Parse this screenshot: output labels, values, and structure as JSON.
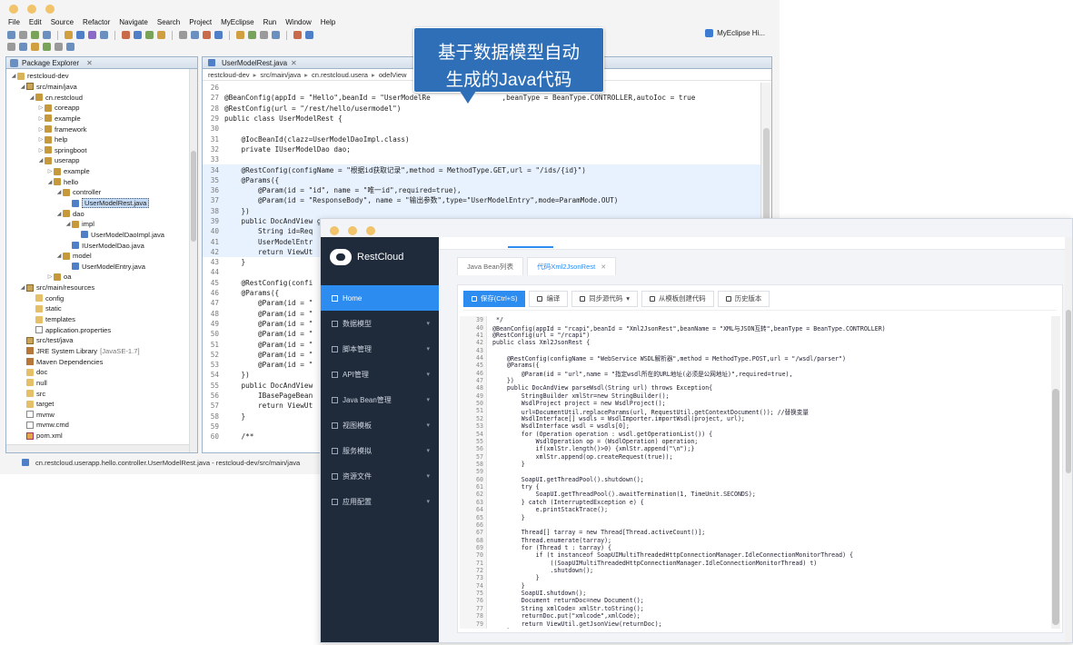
{
  "eclipse": {
    "menu": [
      "File",
      "Edit",
      "Source",
      "Refactor",
      "Navigate",
      "Search",
      "Project",
      "MyEclipse",
      "Run",
      "Window",
      "Help"
    ],
    "perspective_label": "MyEclipse Hi...",
    "package_explorer_title": "Package Explorer",
    "tree": [
      {
        "label": "restcloud-dev",
        "icon": "project-icon",
        "level": 0,
        "expanded": true
      },
      {
        "label": "src/main/java",
        "icon": "source-folder-icon",
        "level": 1,
        "expanded": true
      },
      {
        "label": "cn.restcloud",
        "icon": "package-icon",
        "level": 2,
        "expanded": true
      },
      {
        "label": "coreapp",
        "icon": "package-icon",
        "level": 3,
        "expanded": false
      },
      {
        "label": "example",
        "icon": "package-icon",
        "level": 3,
        "expanded": false
      },
      {
        "label": "framework",
        "icon": "package-icon",
        "level": 3,
        "expanded": false
      },
      {
        "label": "help",
        "icon": "package-icon",
        "level": 3,
        "expanded": false
      },
      {
        "label": "springboot",
        "icon": "package-icon",
        "level": 3,
        "expanded": false
      },
      {
        "label": "userapp",
        "icon": "package-icon",
        "level": 3,
        "expanded": true
      },
      {
        "label": "example",
        "icon": "package-icon",
        "level": 4,
        "expanded": false
      },
      {
        "label": "hello",
        "icon": "package-icon",
        "level": 4,
        "expanded": true
      },
      {
        "label": "controller",
        "icon": "package-icon",
        "level": 5,
        "expanded": true
      },
      {
        "label": "UserModelRest.java",
        "icon": "java-file-icon",
        "level": 6,
        "selected": true
      },
      {
        "label": "dao",
        "icon": "package-icon",
        "level": 5,
        "expanded": true
      },
      {
        "label": "impl",
        "icon": "package-icon",
        "level": 6,
        "expanded": true
      },
      {
        "label": "UserModelDaoImpl.java",
        "icon": "java-file-icon",
        "level": 7
      },
      {
        "label": "IUserModelDao.java",
        "icon": "java-file-icon",
        "level": 6
      },
      {
        "label": "model",
        "icon": "package-icon",
        "level": 5,
        "expanded": true
      },
      {
        "label": "UserModelEntry.java",
        "icon": "java-file-icon",
        "level": 6
      },
      {
        "label": "oa",
        "icon": "package-icon",
        "level": 4,
        "expanded": false
      },
      {
        "label": "src/main/resources",
        "icon": "source-folder-icon",
        "level": 1,
        "expanded": true
      },
      {
        "label": "config",
        "icon": "folder-icon",
        "level": 2
      },
      {
        "label": "static",
        "icon": "folder-icon",
        "level": 2
      },
      {
        "label": "templates",
        "icon": "folder-icon",
        "level": 2
      },
      {
        "label": "application.properties",
        "icon": "file-icon",
        "level": 2
      },
      {
        "label": "src/test/java",
        "icon": "source-folder-icon",
        "level": 1
      },
      {
        "label": "JRE System Library",
        "suffix": "[JavaSE-1.7]",
        "icon": "library-icon",
        "level": 1
      },
      {
        "label": "Maven Dependencies",
        "icon": "library-icon",
        "level": 1
      },
      {
        "label": "doc",
        "icon": "folder-icon",
        "level": 1
      },
      {
        "label": "null",
        "icon": "folder-icon",
        "level": 1
      },
      {
        "label": "src",
        "icon": "folder-icon",
        "level": 1
      },
      {
        "label": "target",
        "icon": "folder-icon",
        "level": 1
      },
      {
        "label": "mvnw",
        "icon": "file-icon",
        "level": 1
      },
      {
        "label": "mvnw.cmd",
        "icon": "file-icon",
        "level": 1
      },
      {
        "label": "pom.xml",
        "icon": "xml-file-icon",
        "level": 1
      }
    ],
    "editor_tab": "UserModelRest.java",
    "breadcrumb": [
      "restcloud-dev",
      "src/main/java",
      "cn.restcloud.usera",
      "odelView"
    ],
    "code_lines": [
      {
        "n": "26",
        "t": ""
      },
      {
        "n": "27",
        "t": "@BeanConfig(appId = \"Hello\",beanId = \"UserModelRe                 ,beanType = BeanType.CONTROLLER,autoIoc = true"
      },
      {
        "n": "28",
        "t": "@RestConfig(url = \"/rest/hello/usermodel\")"
      },
      {
        "n": "29",
        "t": "public class UserModelRest {"
      },
      {
        "n": "30",
        "t": ""
      },
      {
        "n": "31",
        "t": "    @IocBeanId(clazz=UserModelDaoImpl.class)"
      },
      {
        "n": "32",
        "t": "    private IUserModelDao dao;"
      },
      {
        "n": "33",
        "t": ""
      },
      {
        "n": "34",
        "t": "    @RestConfig(configName = \"根据id获取记录\",method = MethodType.GET,url = \"/ids/{id}\")"
      },
      {
        "n": "35",
        "t": "    @Params({"
      },
      {
        "n": "36",
        "t": "        @Param(id = \"id\", name = \"唯一id\",required=true),"
      },
      {
        "n": "37",
        "t": "        @Param(id = \"ResponseBody\", name = \"输出参数\",type=\"UserModelEntry\",mode=ParamMode.OUT)"
      },
      {
        "n": "38",
        "t": "    })"
      },
      {
        "n": "39",
        "t": "    public DocAndView getById() throws Exception{"
      },
      {
        "n": "40",
        "t": "        String id=Req"
      },
      {
        "n": "41",
        "t": "        UserModelEntr"
      },
      {
        "n": "42",
        "t": "        return ViewUt"
      },
      {
        "n": "43",
        "t": "    }"
      },
      {
        "n": "44",
        "t": ""
      },
      {
        "n": "45",
        "t": "    @RestConfig(confi"
      },
      {
        "n": "46",
        "t": "    @Params({"
      },
      {
        "n": "47",
        "t": "        @Param(id = \""
      },
      {
        "n": "48",
        "t": "        @Param(id = \""
      },
      {
        "n": "49",
        "t": "        @Param(id = \""
      },
      {
        "n": "50",
        "t": "        @Param(id = \""
      },
      {
        "n": "51",
        "t": "        @Param(id = \""
      },
      {
        "n": "52",
        "t": "        @Param(id = \""
      },
      {
        "n": "53",
        "t": "        @Param(id = \""
      },
      {
        "n": "54",
        "t": "    })"
      },
      {
        "n": "55",
        "t": "    public DocAndView"
      },
      {
        "n": "56",
        "t": "        IBasePageBean"
      },
      {
        "n": "57",
        "t": "        return ViewUt"
      },
      {
        "n": "58",
        "t": "    }"
      },
      {
        "n": "59",
        "t": ""
      },
      {
        "n": "60",
        "t": "    /**"
      }
    ],
    "status_text": "cn.restcloud.userapp.hello.controller.UserModelRest.java - restcloud-dev/src/main/java"
  },
  "callout": {
    "line1": "基于数据模型自动",
    "line2": "生成的Java代码",
    "color": "#2f6fb8"
  },
  "restcloud": {
    "brand": "RestCloud",
    "menu": [
      {
        "label": "Home",
        "active": true,
        "icon": "home-icon"
      },
      {
        "label": "数据模型",
        "chevron": true,
        "icon": "grid-icon"
      },
      {
        "label": "脚本管理",
        "chevron": true,
        "icon": "grid-icon"
      },
      {
        "label": "API管理",
        "chevron": true,
        "icon": "grid-icon"
      },
      {
        "label": "Java Bean管理",
        "chevron": true,
        "icon": "grid-icon"
      },
      {
        "label": "视图模板",
        "chevron": true,
        "icon": "grid-icon"
      },
      {
        "label": "服务模拟",
        "chevron": true,
        "icon": "grid-icon"
      },
      {
        "label": "资源文件",
        "chevron": true,
        "icon": "grid-icon"
      },
      {
        "label": "应用配置",
        "chevron": true,
        "icon": "gear-icon"
      }
    ],
    "tabs": [
      {
        "label": "Java Bean列表",
        "active": false
      },
      {
        "label": "代码Xml2JsonRest",
        "active": true,
        "closable": true
      }
    ],
    "toolbar": [
      {
        "label": "保存(Ctrl+S)",
        "primary": true,
        "icon": "save-icon"
      },
      {
        "label": "编译",
        "icon": "compile-icon"
      },
      {
        "label": "同步源代码",
        "icon": "sync-icon",
        "dropdown": true
      },
      {
        "label": "从模板创建代码",
        "icon": "template-icon"
      },
      {
        "label": "历史版本",
        "icon": "history-icon"
      }
    ],
    "code_lines": [
      {
        "n": "39",
        "t": " */"
      },
      {
        "n": "40",
        "t": "@BeanConfig(appId = \"rcapi\",beanId = \"Xml2JsonRest\",beanName = \"XML与JSON互转\",beanType = BeanType.CONTROLLER)"
      },
      {
        "n": "41",
        "t": "@RestConfig(url = \"/rcapi\")"
      },
      {
        "n": "42",
        "t": "public class Xml2JsonRest {"
      },
      {
        "n": "43",
        "t": ""
      },
      {
        "n": "44",
        "t": "    @RestConfig(configName = \"WebService WSDL解析器\",method = MethodType.POST,url = \"/wsdl/parser\")"
      },
      {
        "n": "45",
        "t": "    @Params({"
      },
      {
        "n": "46",
        "t": "        @Param(id = \"url\",name = \"指定wsdl所在的URL地址(必须是公网地址)\",required=true),"
      },
      {
        "n": "47",
        "t": "    })"
      },
      {
        "n": "48",
        "t": "    public DocAndView parseWsdl(String url) throws Exception{"
      },
      {
        "n": "49",
        "t": "        StringBuilder xmlStr=new StringBuilder();"
      },
      {
        "n": "50",
        "t": "        WsdlProject project = new WsdlProject();"
      },
      {
        "n": "51",
        "t": "        url=DocumentUtil.replaceParams(url, RequestUtil.getContextDocument()); //替换变量"
      },
      {
        "n": "52",
        "t": "        WsdlInterface[] wsdls = WsdlImporter.importWsdl(project, url);"
      },
      {
        "n": "53",
        "t": "        WsdlInterface wsdl = wsdls[0];"
      },
      {
        "n": "54",
        "t": "        for (Operation operation : wsdl.getOperationList()) {"
      },
      {
        "n": "55",
        "t": "            WsdlOperation op = (WsdlOperation) operation;"
      },
      {
        "n": "56",
        "t": "            if(xmlStr.length()>0) {xmlStr.append(\"\\n\");}"
      },
      {
        "n": "57",
        "t": "            xmlStr.append(op.createRequest(true));"
      },
      {
        "n": "58",
        "t": "        }"
      },
      {
        "n": "59",
        "t": ""
      },
      {
        "n": "60",
        "t": "        SoapUI.getThreadPool().shutdown();"
      },
      {
        "n": "61",
        "t": "        try {"
      },
      {
        "n": "62",
        "t": "            SoapUI.getThreadPool().awaitTermination(1, TimeUnit.SECONDS);"
      },
      {
        "n": "63",
        "t": "        } catch (InterruptedException e) {"
      },
      {
        "n": "64",
        "t": "            e.printStackTrace();"
      },
      {
        "n": "65",
        "t": "        }"
      },
      {
        "n": "66",
        "t": ""
      },
      {
        "n": "67",
        "t": "        Thread[] tarray = new Thread[Thread.activeCount()];"
      },
      {
        "n": "68",
        "t": "        Thread.enumerate(tarray);"
      },
      {
        "n": "69",
        "t": "        for (Thread t : tarray) {"
      },
      {
        "n": "70",
        "t": "            if (t instanceof SoapUIMultiThreadedHttpConnectionManager.IdleConnectionMonitorThread) {"
      },
      {
        "n": "71",
        "t": "                ((SoapUIMultiThreadedHttpConnectionManager.IdleConnectionMonitorThread) t)"
      },
      {
        "n": "72",
        "t": "                .shutdown();"
      },
      {
        "n": "73",
        "t": "            }"
      },
      {
        "n": "74",
        "t": "        }"
      },
      {
        "n": "75",
        "t": "        SoapUI.shutdown();"
      },
      {
        "n": "76",
        "t": "        Document returnDoc=new Document();"
      },
      {
        "n": "77",
        "t": "        String xmlCode= xmlStr.toString();"
      },
      {
        "n": "78",
        "t": "        returnDoc.put(\"xmlcode\",xmlCode);"
      },
      {
        "n": "79",
        "t": "        return ViewUtil.getJsonView(returnDoc);"
      },
      {
        "n": "80",
        "t": "    }"
      }
    ]
  }
}
